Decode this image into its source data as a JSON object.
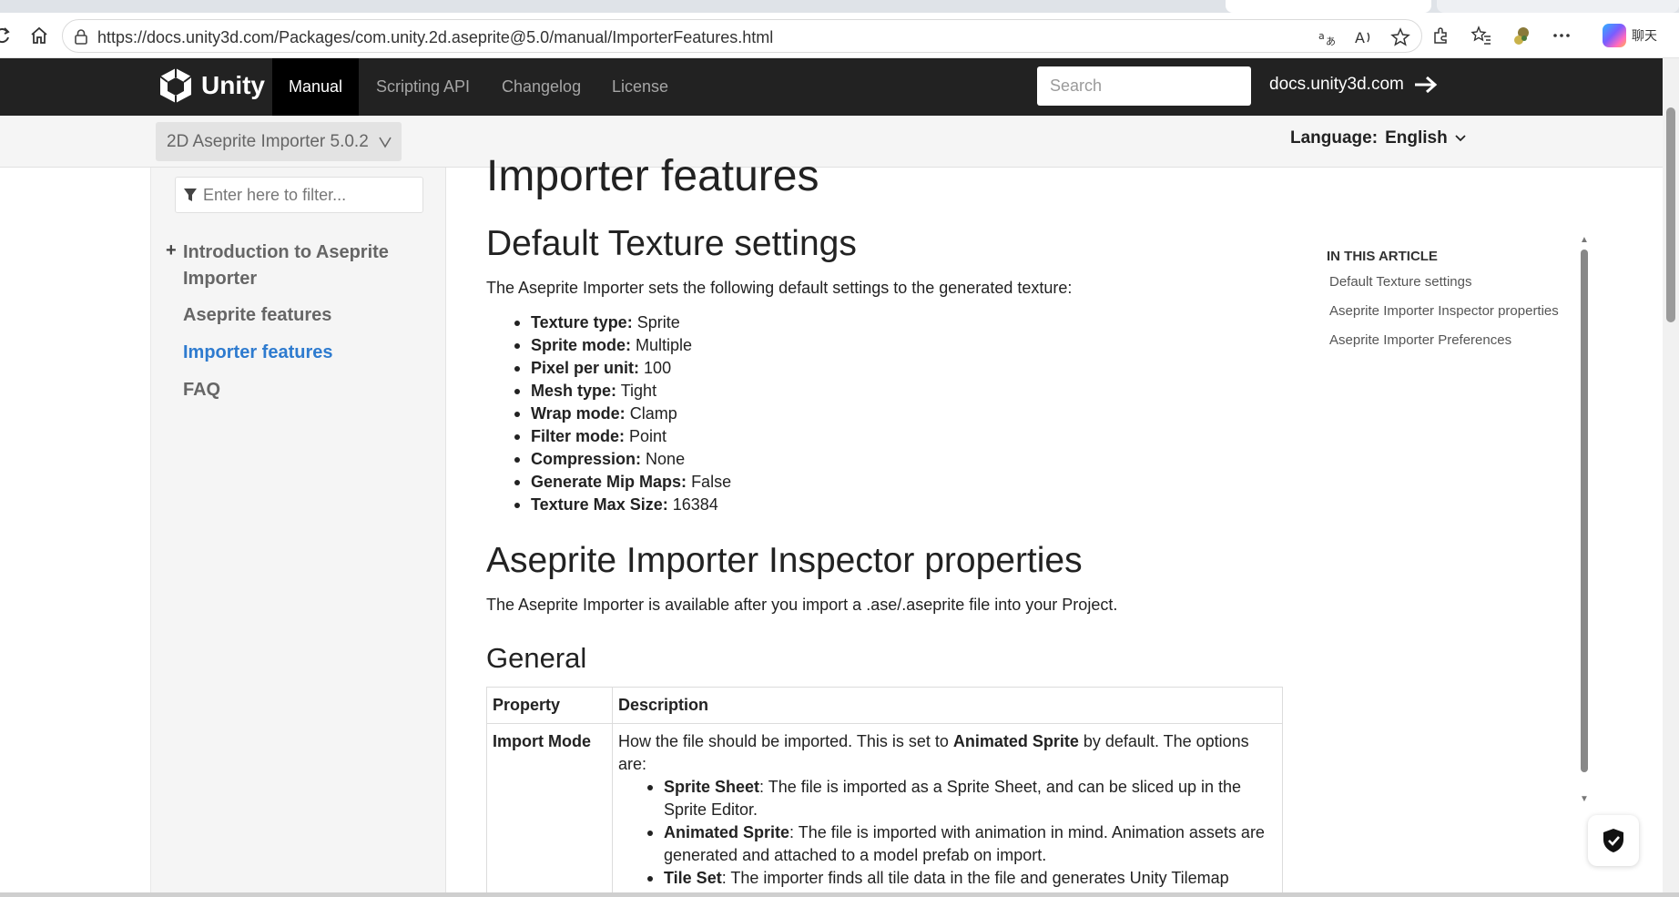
{
  "browser": {
    "url": "https://docs.unity3d.com/Packages/com.unity.2d.aseprite@5.0/manual/ImporterFeatures.html",
    "copilot_label": "聊天"
  },
  "topnav": {
    "brand": "Unity",
    "items": [
      "Manual",
      "Scripting API",
      "Changelog",
      "License"
    ],
    "search_placeholder": "Search",
    "docs_link": "docs.unity3d.com"
  },
  "subheader": {
    "version": "2D Aseprite Importer 5.0.2",
    "language_label": "Language:",
    "language_value": "English"
  },
  "sidebar": {
    "filter_placeholder": "Enter here to filter...",
    "items": [
      {
        "label": "Introduction to Aseprite Importer",
        "line1": "Introduction to Aseprite",
        "line2": "Importer"
      },
      {
        "label": "Aseprite features"
      },
      {
        "label": "Importer features"
      },
      {
        "label": "FAQ"
      }
    ]
  },
  "main": {
    "title": "Importer features",
    "section1": {
      "heading": "Default Texture settings",
      "intro": "The Aseprite Importer sets the following default settings to the generated texture:",
      "settings": [
        {
          "name": "Texture type:",
          "value": "Sprite"
        },
        {
          "name": "Sprite mode:",
          "value": "Multiple"
        },
        {
          "name": "Pixel per unit:",
          "value": "100"
        },
        {
          "name": "Mesh type:",
          "value": "Tight"
        },
        {
          "name": "Wrap mode:",
          "value": "Clamp"
        },
        {
          "name": "Filter mode:",
          "value": "Point"
        },
        {
          "name": "Compression:",
          "value": "None"
        },
        {
          "name": "Generate Mip Maps:",
          "value": "False"
        },
        {
          "name": "Texture Max Size:",
          "value": "16384"
        }
      ]
    },
    "section2": {
      "heading": "Aseprite Importer Inspector properties",
      "intro": "The Aseprite Importer is available after you import a .ase/.aseprite file into your Project.",
      "subheading": "General",
      "table": {
        "headers": [
          "Property",
          "Description"
        ],
        "row": {
          "property": "Import Mode",
          "desc_pre": "How the file should be imported. This is set to ",
          "desc_bold": "Animated Sprite",
          "desc_post": " by default. The options are:",
          "options": [
            {
              "name": "Sprite Sheet",
              "text": ": The file is imported as a Sprite Sheet, and can be sliced up in the Sprite Editor."
            },
            {
              "name": "Animated Sprite",
              "text": ": The file is imported with animation in mind. Animation assets are generated and attached to a model prefab on import."
            },
            {
              "name": "Tile Set",
              "text": ": The importer finds all tile data in the file and generates Unity Tilemap assets on import."
            }
          ]
        }
      }
    }
  },
  "article_toc": {
    "label": "IN THIS ARTICLE",
    "links": [
      "Default Texture settings",
      "Aseprite Importer Inspector properties",
      "Aseprite Importer Preferences"
    ]
  }
}
